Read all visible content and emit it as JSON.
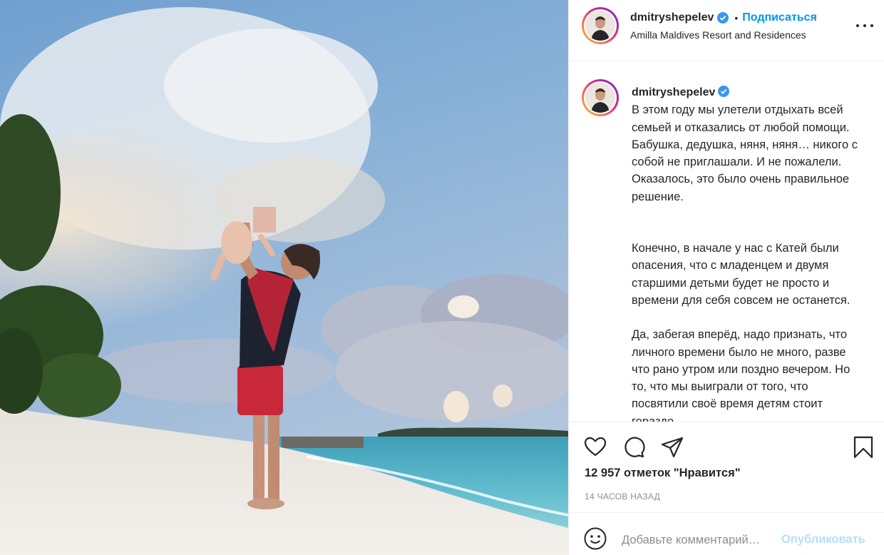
{
  "post": {
    "author": {
      "username": "dmitryshepelev",
      "verified": true,
      "follow_label": "Подписаться",
      "location": "Amilla Maldives Resort and Residences",
      "separator": "•"
    },
    "caption": {
      "paragraphs": [
        "В этом году мы улетели отдыхать всей семьей и отказались от любой помощи. Бабушка, дедушка, няня, няня… никого с собой не приглашали. И не пожалели. Оказалось, это было очень правильное решение.",
        "Конечно, в начале у нас с Катей были опасения, что с младенцем и двумя старшими детьми будет не просто и времени для себя совсем не останется.",
        "Да, забегая вперёд, надо признать, что личного времени было не много, разве что рано утром или поздно вечером. Но то, что мы выиграли от того, что посвятили своё время детям стоит гораздо"
      ]
    },
    "likes_text": "12 957 отметок \"Нравится\"",
    "time_ago": "14 ЧАСОВ НАЗАД",
    "comment_box": {
      "placeholder": "Добавьте комментарий…",
      "publish_label": "Опубликовать"
    },
    "icons": {
      "like": "heart-icon",
      "comment": "comment-icon",
      "share": "paper-plane-icon",
      "save": "bookmark-icon",
      "more": "more-dots-icon",
      "emoji": "emoji-icon",
      "verified": "verified-badge-icon"
    },
    "colors": {
      "link": "#0095f6",
      "publish_disabled": "#b2dffc",
      "verified": "#3897f0",
      "secondary_text": "#8e8e8e"
    }
  }
}
